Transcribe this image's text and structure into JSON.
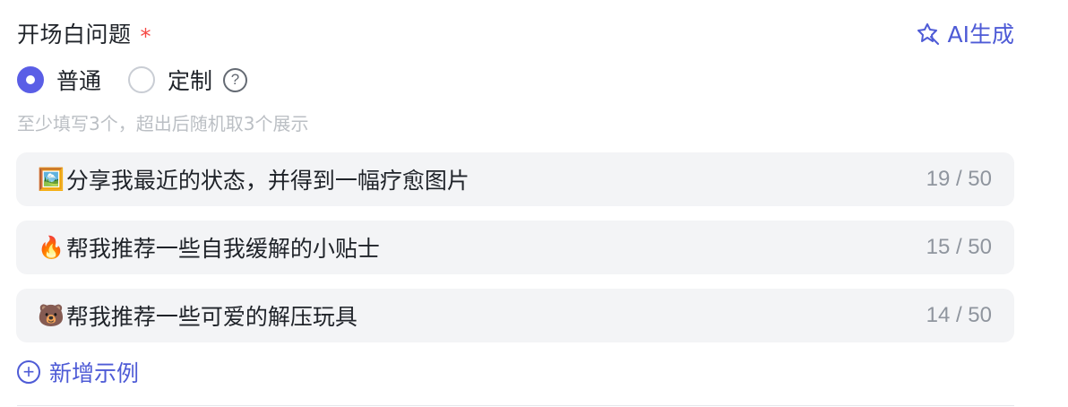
{
  "field": {
    "title": "开场白问题",
    "required_mark": "*",
    "ai_button": "AI生成"
  },
  "mode": {
    "options": [
      {
        "label": "普通",
        "selected": true
      },
      {
        "label": "定制",
        "selected": false
      }
    ],
    "help_icon": "?"
  },
  "hint": "至少填写3个，超出后随机取3个展示",
  "examples": [
    {
      "icon": "🖼️",
      "text": "分享我最近的状态，并得到一幅疗愈图片",
      "count": "19 / 50"
    },
    {
      "icon": "🔥",
      "text": "帮我推荐一些自我缓解的小贴士",
      "count": "15 / 50"
    },
    {
      "icon": "🐻",
      "text": "帮我推荐一些可爱的解压玩具",
      "count": "14 / 50"
    }
  ],
  "add_button": {
    "icon": "+",
    "label": "新增示例"
  },
  "colors": {
    "accent": "#4e5bd6",
    "radio_selected": "#5a5ee6",
    "required": "#f54a45",
    "item_bg": "#f3f4f6",
    "hint": "#bbbfc4",
    "counter": "#8f959e"
  }
}
